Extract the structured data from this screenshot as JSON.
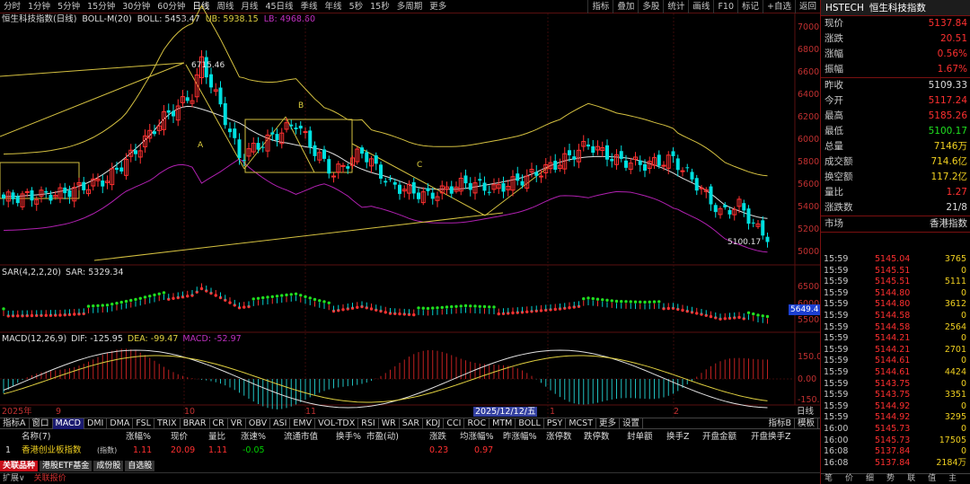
{
  "toolbar": {
    "periods": [
      "分时",
      "1分钟",
      "5分钟",
      "15分钟",
      "30分钟",
      "60分钟",
      "日线",
      "周线",
      "月线",
      "45日线",
      "季线",
      "年线",
      "5秒",
      "15秒",
      "多周期",
      "更多"
    ],
    "active_period": "日线",
    "right_buttons": [
      "指标",
      "叠加",
      "多股",
      "统计",
      "画线",
      "F10",
      "标记",
      "+自选",
      "返回"
    ]
  },
  "main_chart": {
    "name": "恒生科技指数(日线)",
    "indicator": "BOLL-M(20)",
    "boll": "BOLL: 5453.47",
    "ub": "UB: 5938.15",
    "lb": "LB: 4968.60",
    "axis_ticks": [
      "7000",
      "6800",
      "6600",
      "6400",
      "6200",
      "6000",
      "5800",
      "5600",
      "5400",
      "5200",
      "5000"
    ],
    "high_label": "6715.46",
    "low_label": "5100.17",
    "annotations": [
      "A",
      "B",
      "C"
    ]
  },
  "sar_panel": {
    "label": "SAR(4,2,2,20)",
    "value": "SAR: 5329.34",
    "axis_ticks": [
      "6500",
      "6000",
      "5500"
    ],
    "current_tag": "5649.4"
  },
  "macd_panel": {
    "label": "MACD(12,26,9)",
    "dif": "DIF: -125.95",
    "dea": "DEA: -99.47",
    "macd": "MACD: -52.97",
    "axis_ticks": [
      "150.0",
      "0.00",
      "-150.0"
    ]
  },
  "time_axis": {
    "labels": [
      "2025年",
      "9",
      "10",
      "11",
      "2025/12/12/五",
      "1",
      "2"
    ],
    "day_button": "日线"
  },
  "indicator_tabs": [
    "指标A",
    "窗口",
    "MACD",
    "DMI",
    "DMA",
    "FSL",
    "TRIX",
    "BRAR",
    "CR",
    "VR",
    "OBV",
    "ASI",
    "EMV",
    "VOL-TDX",
    "RSI",
    "WR",
    "SAR",
    "KDJ",
    "CCI",
    "ROC",
    "MTM",
    "BOLL",
    "PSY",
    "MCST",
    "更多",
    "设置"
  ],
  "indicator_tabs_right": [
    "指标B",
    "模板"
  ],
  "table": {
    "headers": [
      "名称(7)",
      "涨幅%",
      "现价",
      "量比",
      "涨速%",
      "流通市值",
      "换手%",
      "市盈(动)",
      "涨跌",
      "均涨幅%",
      "昨涨幅%",
      "涨停数",
      "跌停数",
      "封单额",
      "换手Z",
      "开盘金额",
      "开盘换手Z"
    ],
    "row": {
      "index": "1",
      "name": "香港创业板指数",
      "tag": "(指数)",
      "change_pct": "1.11",
      "price": "20.09",
      "vol_ratio": "1.11",
      "speed": "-0.05",
      "change": "0.23",
      "avg_change": "0.97"
    }
  },
  "bottom_tabs": [
    "关联品种",
    "港股ETF基金",
    "成份股",
    "自选股"
  ],
  "status_bar": [
    "扩展∨",
    "关联报价"
  ],
  "right_panel": {
    "title_code": "HSTECH",
    "title_name": "恒生科技指数",
    "rows_top": [
      {
        "k": "现价",
        "v": "5137.84"
      },
      {
        "k": "涨跌",
        "v": "20.51"
      },
      {
        "k": "涨幅",
        "v": "0.56%"
      },
      {
        "k": "振幅",
        "v": "1.67%"
      }
    ],
    "rows_mid": [
      {
        "k": "昨收",
        "v": "5109.33"
      },
      {
        "k": "今开",
        "v": "5117.24"
      },
      {
        "k": "最高",
        "v": "5185.26"
      },
      {
        "k": "最低",
        "v": "5100.17"
      },
      {
        "k": "总量",
        "v": "7146万"
      },
      {
        "k": "成交额",
        "v": "714.6亿"
      },
      {
        "k": "换空额",
        "v": "117.2亿"
      },
      {
        "k": "量比",
        "v": "1.27"
      },
      {
        "k": "涨跌数",
        "v": "21/8"
      }
    ],
    "market": {
      "k": "市场",
      "v": "香港指数"
    },
    "ticks": [
      {
        "t": "15:59",
        "p": "5145.04",
        "v": "3765"
      },
      {
        "t": "15:59",
        "p": "5145.51",
        "v": "0"
      },
      {
        "t": "15:59",
        "p": "5145.51",
        "v": "5111"
      },
      {
        "t": "15:59",
        "p": "5144.80",
        "v": "0"
      },
      {
        "t": "15:59",
        "p": "5144.80",
        "v": "3612"
      },
      {
        "t": "15:59",
        "p": "5144.58",
        "v": "0"
      },
      {
        "t": "15:59",
        "p": "5144.58",
        "v": "2564"
      },
      {
        "t": "15:59",
        "p": "5144.21",
        "v": "0"
      },
      {
        "t": "15:59",
        "p": "5144.21",
        "v": "2701"
      },
      {
        "t": "15:59",
        "p": "5144.61",
        "v": "0"
      },
      {
        "t": "15:59",
        "p": "5144.61",
        "v": "4424"
      },
      {
        "t": "15:59",
        "p": "5143.75",
        "v": "0"
      },
      {
        "t": "15:59",
        "p": "5143.75",
        "v": "3351"
      },
      {
        "t": "15:59",
        "p": "5144.92",
        "v": "0"
      },
      {
        "t": "15:59",
        "p": "5144.92",
        "v": "3295"
      },
      {
        "t": "16:00",
        "p": "5145.73",
        "v": "0"
      },
      {
        "t": "16:00",
        "p": "5145.73",
        "v": "17505"
      },
      {
        "t": "16:08",
        "p": "5137.84",
        "v": "0"
      },
      {
        "t": "16:08",
        "p": "5137.84",
        "v": "2184万"
      }
    ],
    "bottom": [
      "笔",
      "价",
      "细",
      "势",
      "联",
      "值",
      "主"
    ]
  },
  "colors": {
    "up": "#ff3030",
    "down": "#00e0e0",
    "boll_upper": "#d4c040",
    "boll_mid": "#e0e0e0",
    "boll_lower": "#b020b0",
    "trend": "#d4c040"
  }
}
